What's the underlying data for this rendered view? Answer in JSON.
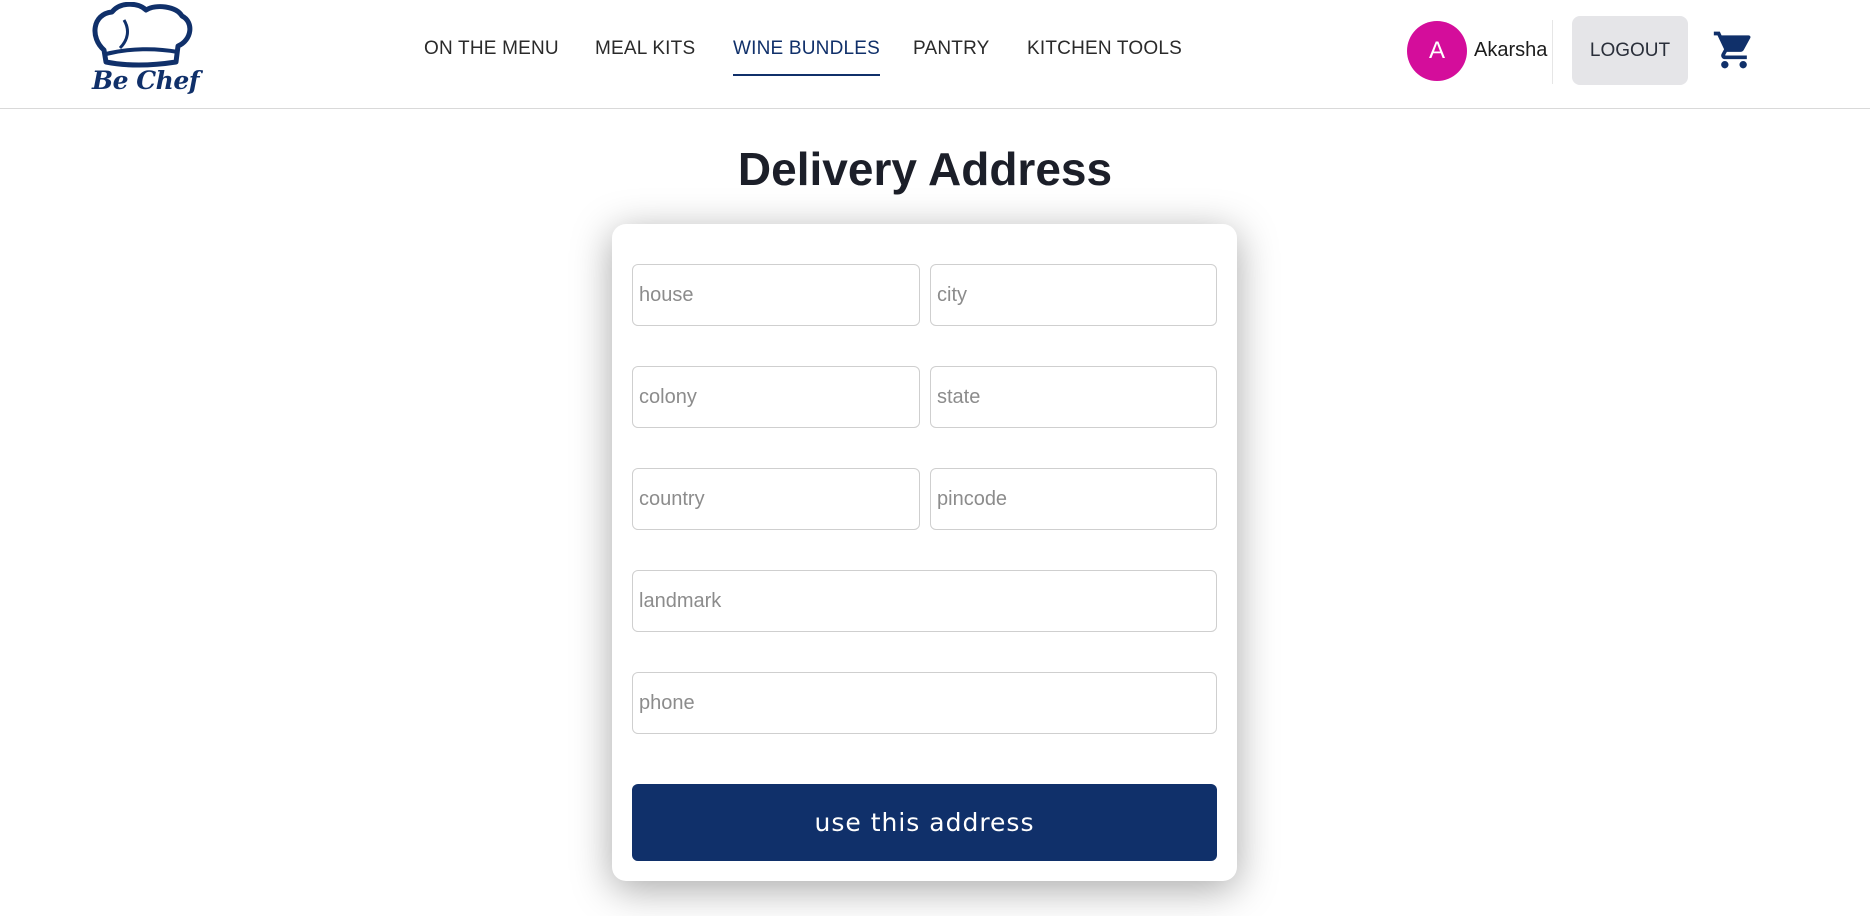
{
  "brand": {
    "name": "Be Chef",
    "logo_icon": "chef-hat-icon"
  },
  "nav": {
    "items": [
      {
        "label": "ON THE MENU",
        "active": false
      },
      {
        "label": "MEAL KITS",
        "active": false
      },
      {
        "label": "WINE BUNDLES",
        "active": true
      },
      {
        "label": "PANTRY",
        "active": false
      },
      {
        "label": "KITCHEN TOOLS",
        "active": false
      }
    ]
  },
  "user": {
    "initial": "A",
    "name": "Akarsha",
    "avatar_color": "#d40d9b"
  },
  "actions": {
    "logout_label": "LOGOUT",
    "cart_icon": "cart-icon"
  },
  "page": {
    "title": "Delivery Address"
  },
  "form": {
    "house": {
      "value": "",
      "placeholder": "house"
    },
    "city": {
      "value": "",
      "placeholder": "city"
    },
    "colony": {
      "value": "",
      "placeholder": "colony"
    },
    "state": {
      "value": "",
      "placeholder": "state"
    },
    "country": {
      "value": "",
      "placeholder": "country"
    },
    "pincode": {
      "value": "",
      "placeholder": "pincode"
    },
    "landmark": {
      "value": "",
      "placeholder": "landmark"
    },
    "phone": {
      "value": "",
      "placeholder": "phone"
    },
    "submit_label": "use this address"
  },
  "colors": {
    "brand": "#10306a",
    "accent": "#d40d9b",
    "logout_bg": "#e5e5e8"
  }
}
